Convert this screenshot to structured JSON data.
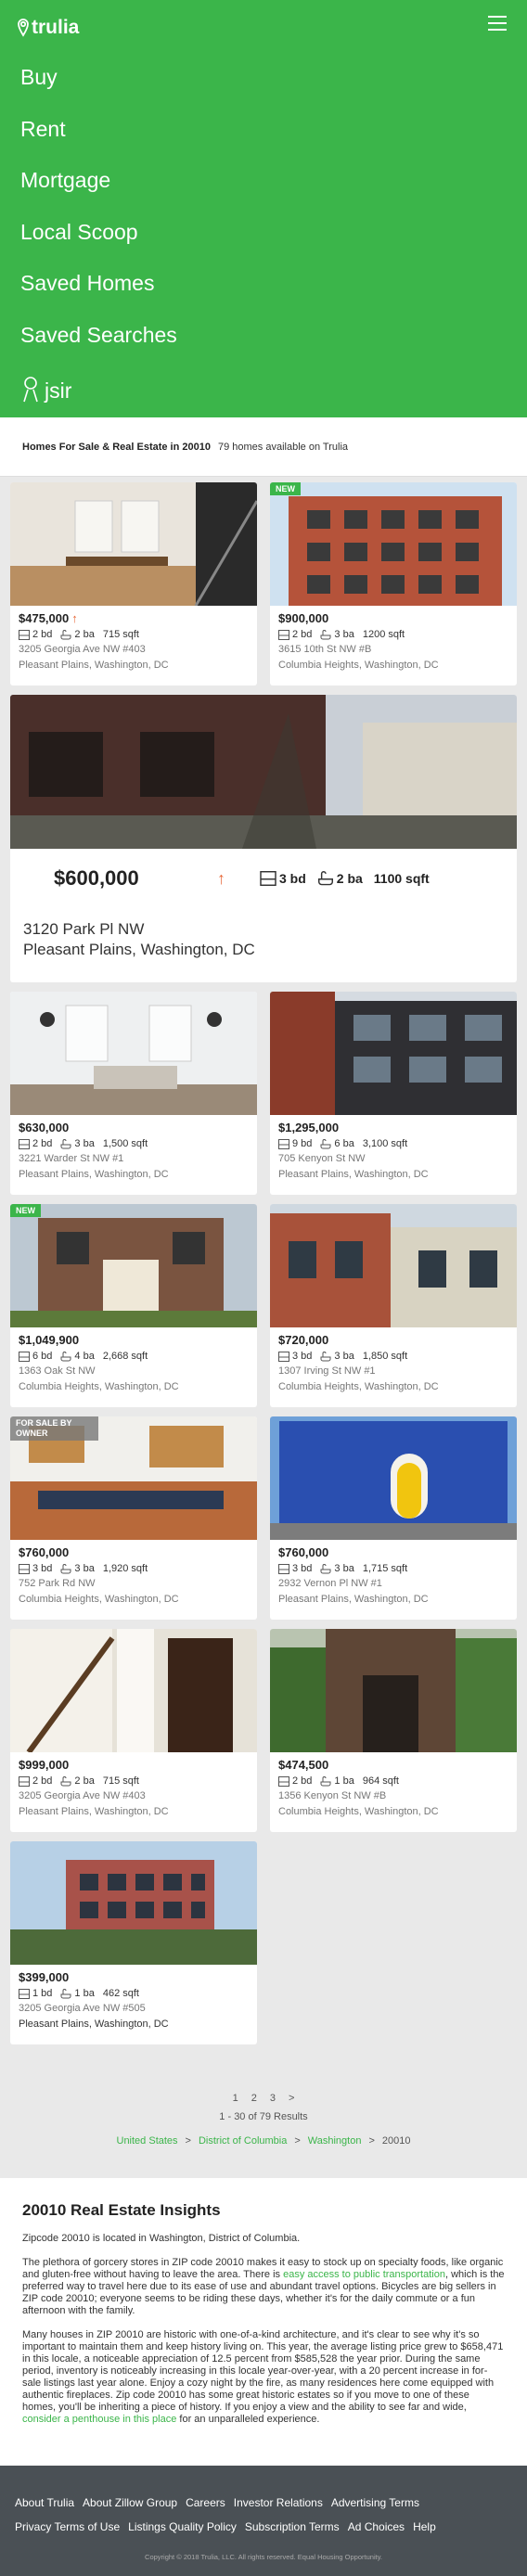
{
  "brand": {
    "logo_text": "trulia",
    "accent": "#3bb54a",
    "price_up_color": "#e86b3c"
  },
  "nav": {
    "items": [
      "Buy",
      "Rent",
      "Mortgage",
      "Local Scoop",
      "Saved Homes",
      "Saved Searches"
    ],
    "user": "jsir",
    "menu_icon": "hamburger-icon"
  },
  "header": {
    "title": "Homes For Sale & Real Estate in 20010",
    "count": "79 homes available on Trulia"
  },
  "listings": [
    {
      "price": "$475,000",
      "trend": "↑",
      "bd": "2 bd",
      "ba": "2 ba",
      "sqft": "715 sqft",
      "street": "3205 Georgia Ave NW #403",
      "area": "Pleasant Plains, Washington, DC",
      "badge": ""
    },
    {
      "price": "$900,000",
      "trend": "",
      "bd": "2 bd",
      "ba": "3 ba",
      "sqft": "1200 sqft",
      "street": "3615 10th St NW #B",
      "area": "Columbia Heights, Washington, DC",
      "badge": "NEW"
    },
    {
      "price": "$630,000",
      "trend": "",
      "bd": "2 bd",
      "ba": "3 ba",
      "sqft": "1,500 sqft",
      "street": "3221 Warder St NW #1",
      "area": "Pleasant Plains, Washington, DC",
      "badge": ""
    },
    {
      "price": "$1,295,000",
      "trend": "",
      "bd": "9 bd",
      "ba": "6 ba",
      "sqft": "3,100 sqft",
      "street": "705 Kenyon St NW",
      "area": "Pleasant Plains, Washington, DC",
      "badge": ""
    },
    {
      "price": "$1,049,900",
      "trend": "",
      "bd": "6 bd",
      "ba": "4 ba",
      "sqft": "2,668 sqft",
      "street": "1363 Oak St NW",
      "area": "Columbia Heights, Washington, DC",
      "badge": "NEW"
    },
    {
      "price": "$720,000",
      "trend": "",
      "bd": "3 bd",
      "ba": "3 ba",
      "sqft": "1,850 sqft",
      "street": "1307 Irving St NW #1",
      "area": "Columbia Heights, Washington, DC",
      "badge": ""
    },
    {
      "price": "$760,000",
      "trend": "",
      "bd": "3 bd",
      "ba": "3 ba",
      "sqft": "1,920 sqft",
      "street": "752 Park Rd NW",
      "area": "Columbia Heights, Washington, DC",
      "badge": "FOR SALE BY OWNER"
    },
    {
      "price": "$760,000",
      "trend": "",
      "bd": "3 bd",
      "ba": "3 ba",
      "sqft": "1,715 sqft",
      "street": "2932 Vernon Pl NW #1",
      "area": "Pleasant Plains, Washington, DC",
      "badge": ""
    },
    {
      "price": "$999,000",
      "trend": "",
      "bd": "2 bd",
      "ba": "2 ba",
      "sqft": "715 sqft",
      "street": "3205 Georgia Ave NW #403",
      "area": "Pleasant Plains, Washington, DC",
      "badge": ""
    },
    {
      "price": "$474,500",
      "trend": "",
      "bd": "2 bd",
      "ba": "1 ba",
      "sqft": "964 sqft",
      "street": "1356 Kenyon St NW #B",
      "area": "Columbia Heights, Washington, DC",
      "badge": ""
    },
    {
      "price": "$399,000",
      "trend": "",
      "bd": "1 bd",
      "ba": "1 ba",
      "sqft": "462 sqft",
      "street": "3205 Georgia Ave NW #505",
      "area": "Pleasant Plains, Washington, DC",
      "badge": ""
    }
  ],
  "featured": {
    "price": "$600,000",
    "trend": "↑",
    "bd": "3 bd",
    "ba": "2 ba",
    "sqft": "1100 sqft",
    "street": "3120 Park Pl NW",
    "area": "Pleasant Plains, Washington, DC"
  },
  "pager": {
    "pages": [
      "1",
      "2",
      "3",
      ">"
    ],
    "range": "1 - 30 of 79 Results"
  },
  "breadcrumb": [
    "United States",
    "District of Columbia",
    "Washington",
    "20010"
  ],
  "insights": {
    "title": "20010 Real Estate Insights",
    "p1": "Zipcode 20010 is located in Washington, District of Columbia.",
    "p2_a": "The plethora of gorcery stores in ZIP code 20010 makes it easy to stock up on specialty foods, like organic and gluten-free without having to leave the area. There is ",
    "p2_link": "easy access to public transportation",
    "p2_b": ", which is the preferred way to travel here due to its ease of use and abundant travel options. Bicycles are big sellers in ZIP code 20010; everyone seems to be riding these days, whether it's for the daily commute or a fun afternoon with the family.",
    "p3_a": "Many houses in ZIP 20010 are historic with one-of-a-kind architecture, and it's clear to see why it's so important to maintain them and keep history living on. This year, the average listing price grew to $658,471 in this locale, a noticeable appreciation of 12.5 percent from $585,528 the year prior. During the same period, inventory is noticeably increasing in this locale year-over-year, with a 20 percent increase in for-sale listings last year alone. Enjoy a cozy night by the fire, as many residences here come equipped with authentic fireplaces. Zip code 20010 has some great historic estates so if you move to one of these homes, you'll be inheriting a piece of history. If you enjoy a view and the ability to see far and wide, ",
    "p3_link": "consider a penthouse in this place",
    "p3_b": " for an unparalleled experience."
  },
  "footer": {
    "links": [
      "About Trulia",
      "About Zillow Group",
      "Careers",
      "Investor Relations",
      "Advertising Terms",
      "Privacy Terms of Use",
      "Listings Quality Policy",
      "Subscription Terms",
      "Ad Choices",
      "Help"
    ],
    "copyright": "Copyright © 2018 Trulia, LLC. All rights reserved. Equal Housing Opportunity."
  }
}
